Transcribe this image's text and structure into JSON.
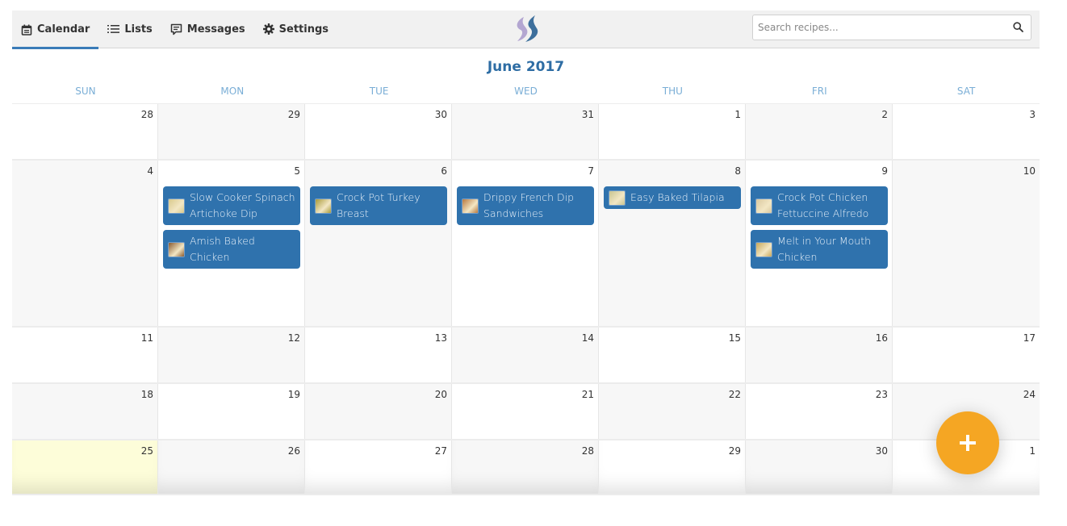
{
  "nav": {
    "items": [
      {
        "label": "Calendar",
        "icon": "calendar-icon",
        "active": true
      },
      {
        "label": "Lists",
        "icon": "list-icon",
        "active": false
      },
      {
        "label": "Messages",
        "icon": "message-icon",
        "active": false
      },
      {
        "label": "Settings",
        "icon": "gear-icon",
        "active": false
      }
    ]
  },
  "search": {
    "placeholder": "Search recipes...",
    "value": "",
    "icon": "search-icon"
  },
  "calendar": {
    "title": "June 2017",
    "day_names": [
      "SUN",
      "MON",
      "TUE",
      "WED",
      "THU",
      "FRI",
      "SAT"
    ],
    "today": "25",
    "weeks": [
      {
        "days": [
          {
            "num": "28",
            "events": []
          },
          {
            "num": "29",
            "events": []
          },
          {
            "num": "30",
            "events": []
          },
          {
            "num": "31",
            "events": []
          },
          {
            "num": "1",
            "events": []
          },
          {
            "num": "2",
            "events": []
          },
          {
            "num": "3",
            "events": []
          }
        ]
      },
      {
        "days": [
          {
            "num": "4",
            "events": []
          },
          {
            "num": "5",
            "events": [
              {
                "title": "Slow Cooker Spinach Artichoke Dip",
                "thumb": "#d8c98c"
              },
              {
                "title": "Amish Baked Chicken",
                "thumb": "#8a5a2e"
              }
            ]
          },
          {
            "num": "6",
            "events": [
              {
                "title": "Crock Pot Turkey Breast",
                "thumb": "#a89a3a"
              }
            ]
          },
          {
            "num": "7",
            "events": [
              {
                "title": "Drippy French Dip Sandwiches",
                "thumb": "#b7783e"
              }
            ]
          },
          {
            "num": "8",
            "events": [
              {
                "title": "Easy Baked Tilapia",
                "thumb": "#c9c490"
              }
            ]
          },
          {
            "num": "9",
            "events": [
              {
                "title": "Crock Pot Chicken Fettuccine Alfredo",
                "thumb": "#d9c8a0"
              },
              {
                "title": "Melt in Your Mouth Chicken",
                "thumb": "#c9a85a"
              }
            ]
          },
          {
            "num": "10",
            "events": []
          }
        ]
      },
      {
        "days": [
          {
            "num": "11",
            "events": []
          },
          {
            "num": "12",
            "events": []
          },
          {
            "num": "13",
            "events": []
          },
          {
            "num": "14",
            "events": []
          },
          {
            "num": "15",
            "events": []
          },
          {
            "num": "16",
            "events": []
          },
          {
            "num": "17",
            "events": []
          }
        ]
      },
      {
        "days": [
          {
            "num": "18",
            "events": []
          },
          {
            "num": "19",
            "events": []
          },
          {
            "num": "20",
            "events": []
          },
          {
            "num": "21",
            "events": []
          },
          {
            "num": "22",
            "events": []
          },
          {
            "num": "23",
            "events": []
          },
          {
            "num": "24",
            "events": []
          }
        ]
      },
      {
        "days": [
          {
            "num": "25",
            "events": []
          },
          {
            "num": "26",
            "events": []
          },
          {
            "num": "27",
            "events": []
          },
          {
            "num": "28",
            "events": []
          },
          {
            "num": "29",
            "events": []
          },
          {
            "num": "30",
            "events": []
          },
          {
            "num": "1",
            "events": []
          }
        ]
      }
    ]
  },
  "fab": {
    "label": "+",
    "icon": "plus-icon"
  },
  "colors": {
    "accent": "#2e6da4",
    "event_bg": "#2f72ad",
    "fab": "#f5a623",
    "today": "#fdfdd9"
  }
}
